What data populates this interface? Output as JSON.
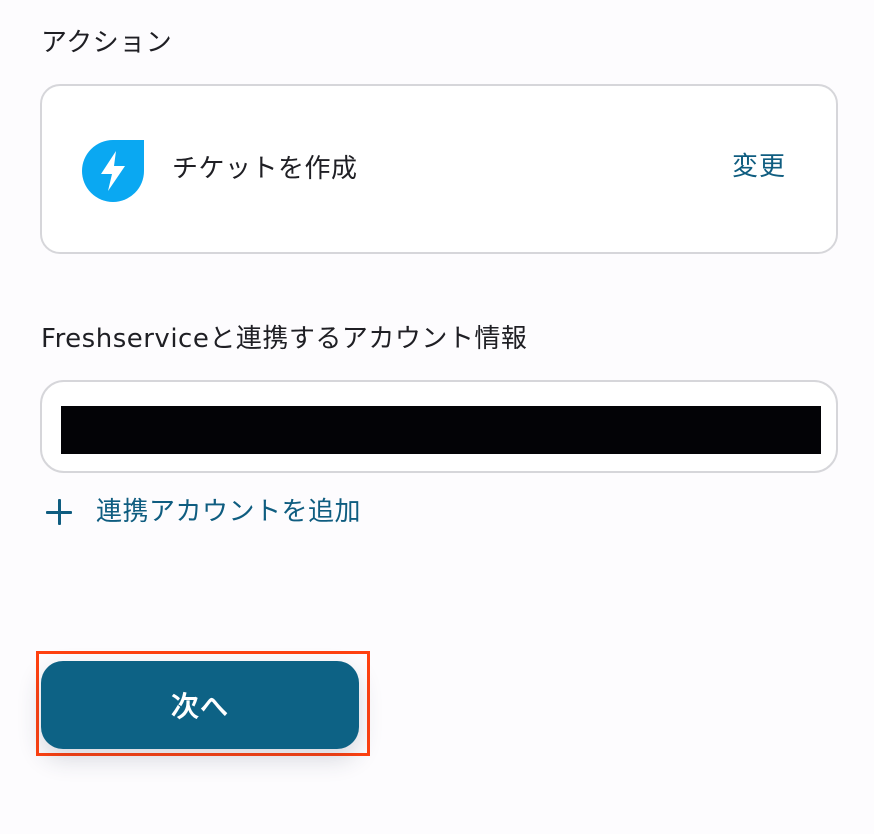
{
  "action_section": {
    "label": "アクション",
    "action_name": "チケットを作成",
    "change_label": "変更",
    "app_icon": "freshservice-lightning-icon"
  },
  "account_section": {
    "label": "Freshserviceと連携するアカウント情報",
    "add_account_label": "連携アカウントを追加"
  },
  "footer": {
    "next_label": "次へ"
  },
  "colors": {
    "accent": "#0d6285",
    "link": "#0f5d80",
    "icon_blue": "#0aa8f2",
    "highlight": "#ff4110",
    "border": "#d6d6da"
  }
}
